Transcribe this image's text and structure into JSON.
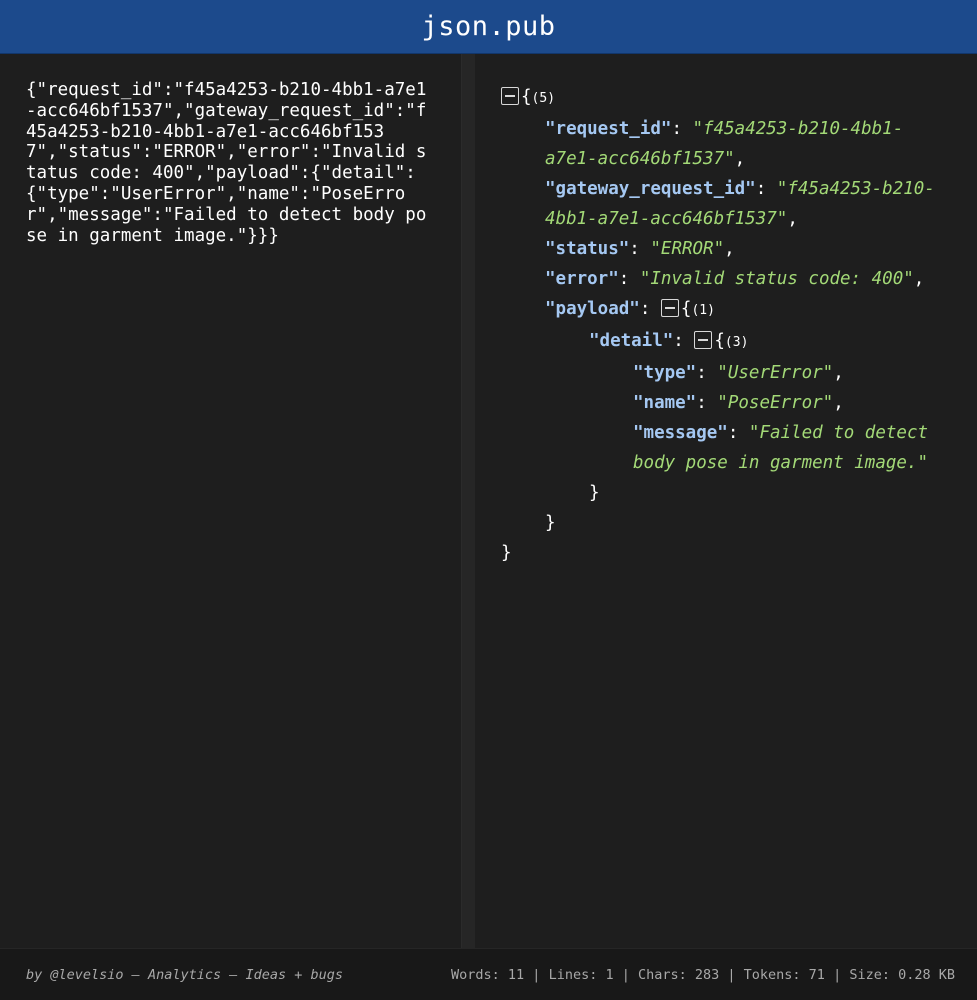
{
  "app": {
    "title": "json.pub"
  },
  "input": {
    "text": "{\"request_id\":\"f45a4253-b210-4bb1-a7e1-acc646bf1537\",\"gateway_request_id\":\"f45a4253-b210-4bb1-a7e1-acc646bf1537\",\"status\":\"ERROR\",\"error\":\"Invalid status code: 400\",\"payload\":{\"detail\":{\"type\":\"UserError\",\"name\":\"PoseError\",\"message\":\"Failed to detect body pose in garment image.\"}}}"
  },
  "tree": {
    "root_open": "{",
    "root_count": "(5)",
    "request_id": {
      "key": "\"request_id\"",
      "value": "\"f45a4253-b210-4bb1-a7e1-acc646bf1537\""
    },
    "gateway_request_id": {
      "key": "\"gateway_request_id\"",
      "value": "\"f45a4253-b210-4bb1-a7e1-acc646bf1537\""
    },
    "status": {
      "key": "\"status\"",
      "value": "\"ERROR\""
    },
    "error": {
      "key": "\"error\"",
      "value": "\"Invalid status code: 400\""
    },
    "payload": {
      "key": "\"payload\"",
      "open": "{",
      "count": "(1)"
    },
    "detail": {
      "key": "\"detail\"",
      "open": "{",
      "count": "(3)"
    },
    "type": {
      "key": "\"type\"",
      "value": "\"UserError\""
    },
    "name": {
      "key": "\"name\"",
      "value": "\"PoseError\""
    },
    "message": {
      "key": "\"message\"",
      "value": "\"Failed to detect body pose in garment image.\""
    },
    "close": "}"
  },
  "footer": {
    "author": "by @levelsio",
    "sep": " – ",
    "analytics": "Analytics",
    "ideas": "Ideas + bugs",
    "words": "Words: 11",
    "lines": "Lines: 1",
    "chars": "Chars: 283",
    "tokens": "Tokens: 71",
    "size": "Size: 0.28 KB",
    "stat_sep": " | "
  },
  "colors": {
    "titlebar": "#1c4a8c",
    "key": "#a5c8f2",
    "string": "#a3d977",
    "background": "#1e1e1e"
  }
}
